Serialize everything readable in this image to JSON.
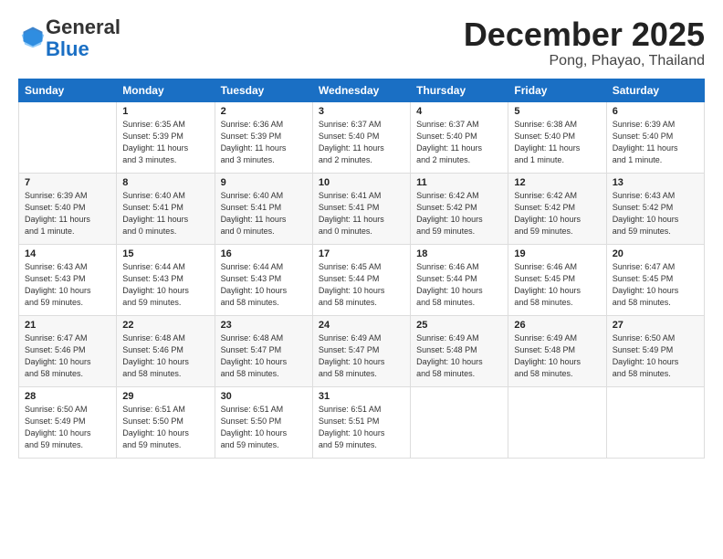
{
  "logo": {
    "general": "General",
    "blue": "Blue"
  },
  "title": "December 2025",
  "location": "Pong, Phayao, Thailand",
  "days_of_week": [
    "Sunday",
    "Monday",
    "Tuesday",
    "Wednesday",
    "Thursday",
    "Friday",
    "Saturday"
  ],
  "weeks": [
    [
      {
        "day": "",
        "text": ""
      },
      {
        "day": "1",
        "text": "Sunrise: 6:35 AM\nSunset: 5:39 PM\nDaylight: 11 hours\nand 3 minutes."
      },
      {
        "day": "2",
        "text": "Sunrise: 6:36 AM\nSunset: 5:39 PM\nDaylight: 11 hours\nand 3 minutes."
      },
      {
        "day": "3",
        "text": "Sunrise: 6:37 AM\nSunset: 5:40 PM\nDaylight: 11 hours\nand 2 minutes."
      },
      {
        "day": "4",
        "text": "Sunrise: 6:37 AM\nSunset: 5:40 PM\nDaylight: 11 hours\nand 2 minutes."
      },
      {
        "day": "5",
        "text": "Sunrise: 6:38 AM\nSunset: 5:40 PM\nDaylight: 11 hours\nand 1 minute."
      },
      {
        "day": "6",
        "text": "Sunrise: 6:39 AM\nSunset: 5:40 PM\nDaylight: 11 hours\nand 1 minute."
      }
    ],
    [
      {
        "day": "7",
        "text": "Sunrise: 6:39 AM\nSunset: 5:40 PM\nDaylight: 11 hours\nand 1 minute."
      },
      {
        "day": "8",
        "text": "Sunrise: 6:40 AM\nSunset: 5:41 PM\nDaylight: 11 hours\nand 0 minutes."
      },
      {
        "day": "9",
        "text": "Sunrise: 6:40 AM\nSunset: 5:41 PM\nDaylight: 11 hours\nand 0 minutes."
      },
      {
        "day": "10",
        "text": "Sunrise: 6:41 AM\nSunset: 5:41 PM\nDaylight: 11 hours\nand 0 minutes."
      },
      {
        "day": "11",
        "text": "Sunrise: 6:42 AM\nSunset: 5:42 PM\nDaylight: 10 hours\nand 59 minutes."
      },
      {
        "day": "12",
        "text": "Sunrise: 6:42 AM\nSunset: 5:42 PM\nDaylight: 10 hours\nand 59 minutes."
      },
      {
        "day": "13",
        "text": "Sunrise: 6:43 AM\nSunset: 5:42 PM\nDaylight: 10 hours\nand 59 minutes."
      }
    ],
    [
      {
        "day": "14",
        "text": "Sunrise: 6:43 AM\nSunset: 5:43 PM\nDaylight: 10 hours\nand 59 minutes."
      },
      {
        "day": "15",
        "text": "Sunrise: 6:44 AM\nSunset: 5:43 PM\nDaylight: 10 hours\nand 59 minutes."
      },
      {
        "day": "16",
        "text": "Sunrise: 6:44 AM\nSunset: 5:43 PM\nDaylight: 10 hours\nand 58 minutes."
      },
      {
        "day": "17",
        "text": "Sunrise: 6:45 AM\nSunset: 5:44 PM\nDaylight: 10 hours\nand 58 minutes."
      },
      {
        "day": "18",
        "text": "Sunrise: 6:46 AM\nSunset: 5:44 PM\nDaylight: 10 hours\nand 58 minutes."
      },
      {
        "day": "19",
        "text": "Sunrise: 6:46 AM\nSunset: 5:45 PM\nDaylight: 10 hours\nand 58 minutes."
      },
      {
        "day": "20",
        "text": "Sunrise: 6:47 AM\nSunset: 5:45 PM\nDaylight: 10 hours\nand 58 minutes."
      }
    ],
    [
      {
        "day": "21",
        "text": "Sunrise: 6:47 AM\nSunset: 5:46 PM\nDaylight: 10 hours\nand 58 minutes."
      },
      {
        "day": "22",
        "text": "Sunrise: 6:48 AM\nSunset: 5:46 PM\nDaylight: 10 hours\nand 58 minutes."
      },
      {
        "day": "23",
        "text": "Sunrise: 6:48 AM\nSunset: 5:47 PM\nDaylight: 10 hours\nand 58 minutes."
      },
      {
        "day": "24",
        "text": "Sunrise: 6:49 AM\nSunset: 5:47 PM\nDaylight: 10 hours\nand 58 minutes."
      },
      {
        "day": "25",
        "text": "Sunrise: 6:49 AM\nSunset: 5:48 PM\nDaylight: 10 hours\nand 58 minutes."
      },
      {
        "day": "26",
        "text": "Sunrise: 6:49 AM\nSunset: 5:48 PM\nDaylight: 10 hours\nand 58 minutes."
      },
      {
        "day": "27",
        "text": "Sunrise: 6:50 AM\nSunset: 5:49 PM\nDaylight: 10 hours\nand 58 minutes."
      }
    ],
    [
      {
        "day": "28",
        "text": "Sunrise: 6:50 AM\nSunset: 5:49 PM\nDaylight: 10 hours\nand 59 minutes."
      },
      {
        "day": "29",
        "text": "Sunrise: 6:51 AM\nSunset: 5:50 PM\nDaylight: 10 hours\nand 59 minutes."
      },
      {
        "day": "30",
        "text": "Sunrise: 6:51 AM\nSunset: 5:50 PM\nDaylight: 10 hours\nand 59 minutes."
      },
      {
        "day": "31",
        "text": "Sunrise: 6:51 AM\nSunset: 5:51 PM\nDaylight: 10 hours\nand 59 minutes."
      },
      {
        "day": "",
        "text": ""
      },
      {
        "day": "",
        "text": ""
      },
      {
        "day": "",
        "text": ""
      }
    ]
  ]
}
